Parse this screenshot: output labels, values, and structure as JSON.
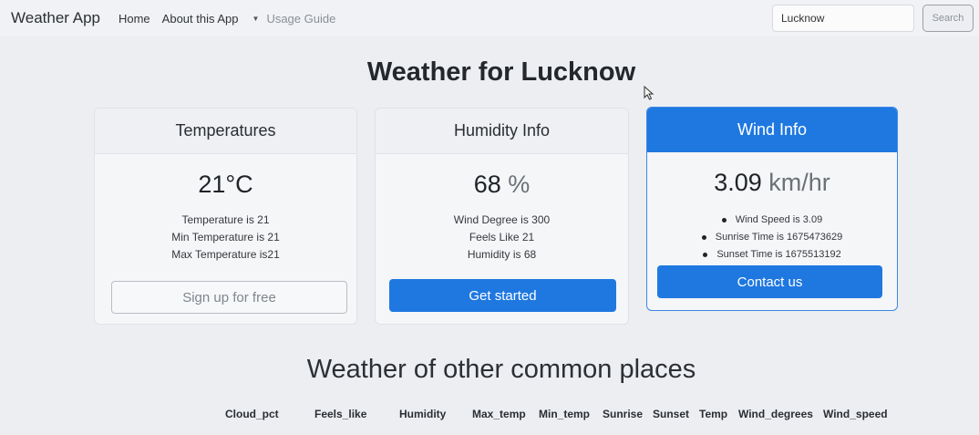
{
  "navbar": {
    "brand": "Weather App",
    "links": [
      "Home",
      "About this App"
    ],
    "dropdown_label": "Usage Guide",
    "search_value": "Lucknow",
    "search_button": "Search"
  },
  "page_title": "Weather for Lucknow",
  "cards": {
    "temperatures": {
      "header": "Temperatures",
      "value": "21°C",
      "lines": [
        "Temperature is 21",
        "Min Temperature is 21",
        "Max Temperature is21"
      ],
      "button": "Sign up for free"
    },
    "humidity": {
      "header": "Humidity Info",
      "value": "68",
      "unit": "%",
      "lines": [
        "Wind Degree is 300",
        "Feels Like 21",
        "Humidity is 68"
      ],
      "button": "Get started"
    },
    "wind": {
      "header": "Wind Info",
      "value": "3.09",
      "unit": "km/hr",
      "items": [
        "Wind Speed is 3.09",
        "Sunrise Time is 1675473629",
        "Sunset Time is 1675513192"
      ],
      "button": "Contact us"
    }
  },
  "other_places": {
    "title": "Weather of other common places",
    "columns": [
      "Cloud_pct",
      "Feels_like",
      "Humidity",
      "Max_temp",
      "Min_temp",
      "Sunrise",
      "Sunset",
      "Temp",
      "Wind_degrees",
      "Wind_speed"
    ]
  },
  "colors": {
    "primary": "#1f78e0",
    "background": "#eceef2"
  }
}
